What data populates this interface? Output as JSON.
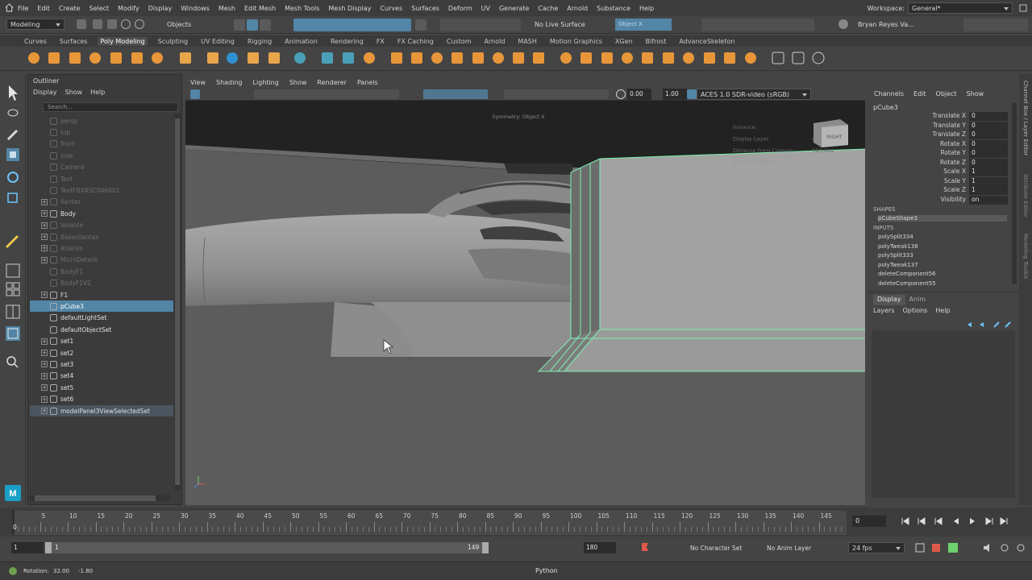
{
  "menubar": {
    "items": [
      "File",
      "Edit",
      "Create",
      "Select",
      "Modify",
      "Display",
      "Windows",
      "Mesh",
      "Edit Mesh",
      "Mesh Tools",
      "Mesh Display",
      "Curves",
      "Surfaces",
      "Deform",
      "UV",
      "Generate",
      "Cache",
      "Arnold",
      "Substance",
      "Help"
    ],
    "workspace_label": "Workspace:",
    "workspace_value": "General*"
  },
  "statusline": {
    "mode": "Modeling",
    "objects_label": "Objects",
    "live_surface": "No Live Surface",
    "object_field": "Object X",
    "user": "Bryan Reyes Va..."
  },
  "shelf": {
    "tabs": [
      "Curves",
      "Surfaces",
      "Poly Modeling",
      "Sculpting",
      "UV Editing",
      "Rigging",
      "Animation",
      "Rendering",
      "FX",
      "FX Caching",
      "Custom",
      "Arnold",
      "MASH",
      "Motion Graphics",
      "XGen",
      "Bifrost",
      "AdvanceSkeleton"
    ],
    "active_tab": "Poly Modeling"
  },
  "outliner": {
    "title": "Outliner",
    "menus": [
      "Display",
      "Show",
      "Help"
    ],
    "search_placeholder": "Search...",
    "rows": [
      {
        "name": "persp",
        "dim": true,
        "expand": false
      },
      {
        "name": "top",
        "dim": true,
        "expand": false
      },
      {
        "name": "front",
        "dim": true,
        "expand": false
      },
      {
        "name": "side",
        "dim": true,
        "expand": false
      },
      {
        "name": "Camera",
        "dim": true,
        "expand": false
      },
      {
        "name": "Text",
        "dim": true,
        "expand": false
      },
      {
        "name": "TextFBXASC046001",
        "dim": true,
        "expand": false
      },
      {
        "name": "llantas",
        "dim": true,
        "expand": true
      },
      {
        "name": "Body",
        "dim": false,
        "expand": true
      },
      {
        "name": "Volante",
        "dim": true,
        "expand": true
      },
      {
        "name": "Basesllantas",
        "dim": true,
        "expand": true
      },
      {
        "name": "Asiento",
        "dim": true,
        "expand": true
      },
      {
        "name": "MicroDetails",
        "dim": true,
        "expand": true
      },
      {
        "name": "BodyF1",
        "dim": true,
        "expand": false
      },
      {
        "name": "BodyF1V2",
        "dim": true,
        "expand": false
      },
      {
        "name": "F1",
        "dim": false,
        "expand": true
      },
      {
        "name": "pCube3",
        "dim": false,
        "expand": false,
        "selected": true
      },
      {
        "name": "defaultLightSet",
        "dim": false,
        "expand": false
      },
      {
        "name": "defaultObjectSet",
        "dim": false,
        "expand": false
      },
      {
        "name": "set1",
        "dim": false,
        "expand": true
      },
      {
        "name": "set2",
        "dim": false,
        "expand": true
      },
      {
        "name": "set3",
        "dim": false,
        "expand": true
      },
      {
        "name": "set4",
        "dim": false,
        "expand": true
      },
      {
        "name": "set5",
        "dim": false,
        "expand": true
      },
      {
        "name": "set6",
        "dim": false,
        "expand": true
      },
      {
        "name": "modelPanel3ViewSelectedSet",
        "dim": false,
        "expand": true,
        "selected_light": true
      }
    ]
  },
  "viewport": {
    "menus": [
      "View",
      "Shading",
      "Lighting",
      "Show",
      "Renderer",
      "Panels"
    ],
    "exposure": "0.00",
    "gamma": "1.00",
    "color_space": "ACES 1.0 SDR-video (sRGB)",
    "symmetry": "Symmetry: Object X",
    "hud": [
      {
        "label": "Instance:",
        "value": ""
      },
      {
        "label": "Display Layer:",
        "value": "default"
      },
      {
        "label": "Distance From Camera:",
        "value": "593.444"
      },
      {
        "label": "Selected Objects:",
        "value": "1"
      }
    ],
    "viewcube_label": "RIGHT"
  },
  "channelbox": {
    "menus": [
      "Channels",
      "Edit",
      "Object",
      "Show"
    ],
    "object": "pCube3",
    "attributes": [
      {
        "name": "Translate X",
        "value": "0"
      },
      {
        "name": "Translate Y",
        "value": "0"
      },
      {
        "name": "Translate Z",
        "value": "0"
      },
      {
        "name": "Rotate X",
        "value": "0"
      },
      {
        "name": "Rotate Y",
        "value": "0"
      },
      {
        "name": "Rotate Z",
        "value": "0"
      },
      {
        "name": "Scale X",
        "value": "1"
      },
      {
        "name": "Scale Y",
        "value": "1"
      },
      {
        "name": "Scale Z",
        "value": "1"
      },
      {
        "name": "Visibility",
        "value": "on"
      }
    ],
    "shapes_label": "SHAPES",
    "shape": "pCubeShape3",
    "inputs_label": "INPUTS",
    "inputs": [
      "polySplit334",
      "polyTweak138",
      "polySplit333",
      "polyTweak137",
      "deleteComponent56",
      "deleteComponent55"
    ],
    "layer_tabs": [
      "Display",
      "Anim"
    ],
    "layer_menus": [
      "Layers",
      "Options",
      "Help"
    ],
    "side_tabs": [
      "Channel Box / Layer Editor",
      "Attribute Editor",
      "Modeling Toolkit"
    ]
  },
  "timeline": {
    "labels": [
      "5",
      "10",
      "15",
      "20",
      "25",
      "30",
      "35",
      "40",
      "45",
      "50",
      "55",
      "60",
      "65",
      "70",
      "75",
      "80",
      "85",
      "90",
      "95",
      "100",
      "105",
      "110",
      "115",
      "120",
      "125",
      "130",
      "135",
      "140",
      "145"
    ],
    "zero": "0",
    "current_frame": "0"
  },
  "range": {
    "start": "1",
    "inner_start": "1",
    "inner_end": "149",
    "end": "180",
    "character_set": "No Character Set",
    "anim_layer": "No Anim Layer",
    "fps": "24 fps"
  },
  "cmdline": {
    "rotation_label": "Rotation:",
    "rot_a": "32.00",
    "rot_b": "-1.80",
    "language": "Python"
  },
  "colors": {
    "accent": "#5285a6",
    "highlight_green": "#7cf0b0",
    "orange_icons": "#e8963a"
  }
}
